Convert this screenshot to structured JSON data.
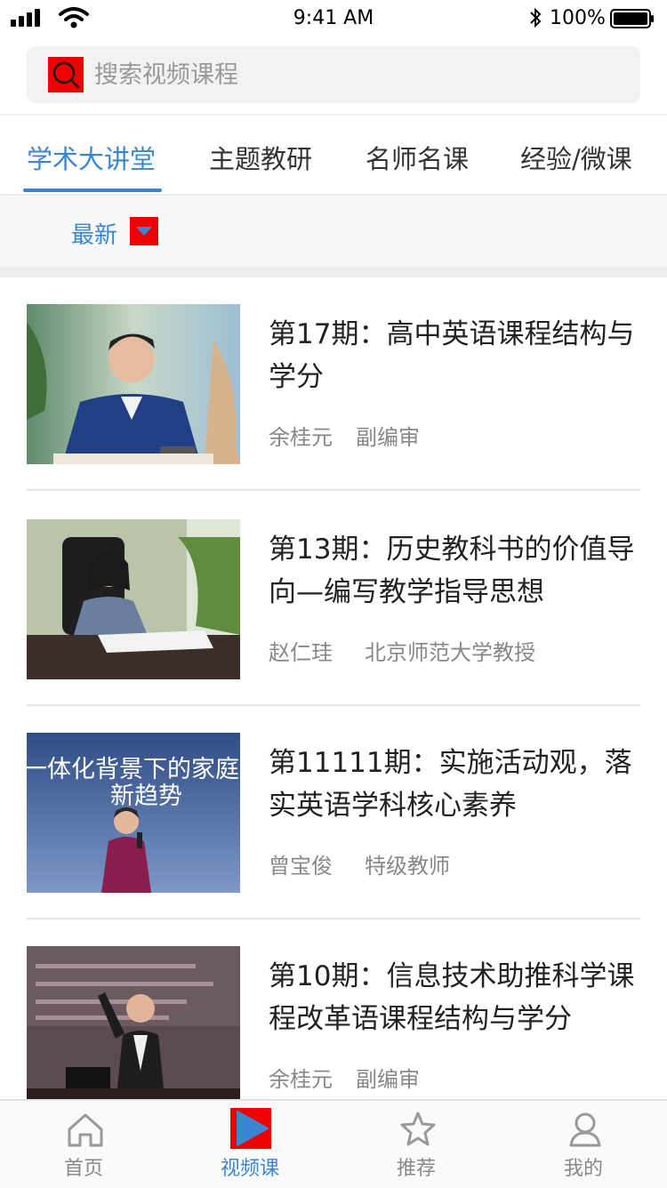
{
  "status": {
    "time": "9:41 AM",
    "battery": "100%"
  },
  "search": {
    "placeholder": "搜索视频课程"
  },
  "tabs": [
    {
      "label": "学术大讲堂",
      "active": true
    },
    {
      "label": "主题教研",
      "active": false
    },
    {
      "label": "名师名课",
      "active": false
    },
    {
      "label": "经验/微课",
      "active": false
    }
  ],
  "filter": {
    "label": "最新"
  },
  "videos": [
    {
      "title": "第17期：高中英语课程结构与学分",
      "speaker": "余桂元",
      "role": "副编审"
    },
    {
      "title": "第13期：历史教科书的价值导向—编写教学指导思想",
      "speaker": "赵仁珪",
      "role": "北京师范大学教授"
    },
    {
      "title": "第11111期：实施活动观，落实英语学科核心素养",
      "speaker": "曾宝俊",
      "role": "特级教师",
      "thumb_text": [
        "一体化背景下的家庭",
        "新趋势"
      ]
    },
    {
      "title": "第10期：信息技术助推科学课程改革语课程结构与学分",
      "speaker": "余桂元",
      "role": "副编审"
    }
  ],
  "bottom_nav": [
    {
      "label": "首页",
      "icon": "home-icon",
      "active": false
    },
    {
      "label": "视频课",
      "icon": "play-icon",
      "active": true
    },
    {
      "label": "推荐",
      "icon": "star-icon",
      "active": false
    },
    {
      "label": "我的",
      "icon": "user-icon",
      "active": false
    }
  ],
  "colors": {
    "accent": "#3a86d4",
    "icon_bg": "#ee0000"
  }
}
